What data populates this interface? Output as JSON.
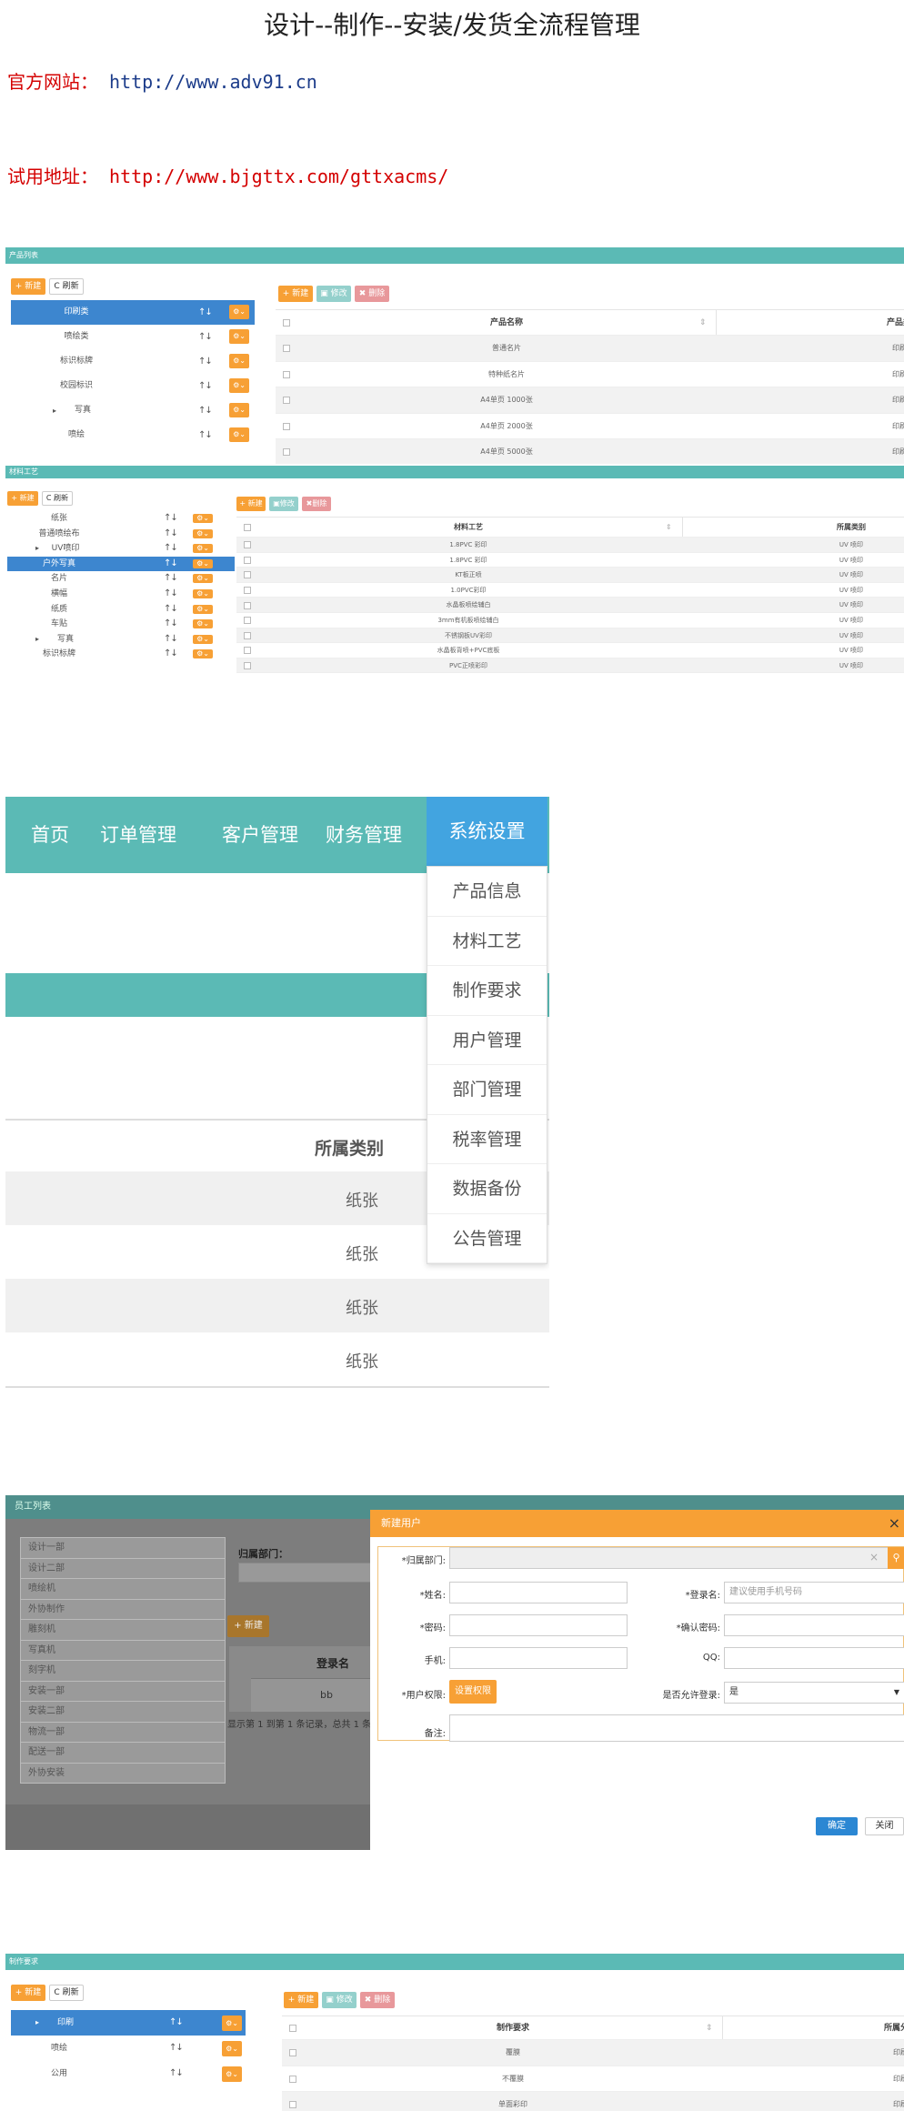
{
  "title": "设计--制作--安装/发货全流程管理",
  "official": {
    "label": "官方网站：",
    "url": "http://www.adv91.cn"
  },
  "trial": {
    "label": "试用地址：",
    "url": "http://www.bjgttx.com/gttxacms/"
  },
  "product_panel": {
    "header": "产品列表",
    "new": "+ 新建",
    "refresh": "C 刷新",
    "g_new": "+ 新建",
    "g_edit": "修改",
    "g_delete": "删除",
    "tree": [
      "印刷类",
      "喷绘类",
      "标识标牌",
      "校园标识",
      "写真",
      "喷绘"
    ],
    "columns": [
      "产品名称",
      "产品类别"
    ],
    "rows": [
      [
        "普通名片",
        "印刷类"
      ],
      [
        "特种纸名片",
        "印刷类"
      ],
      [
        "A4单页 1000张",
        "印刷类"
      ],
      [
        "A4单页 2000张",
        "印刷类"
      ],
      [
        "A4单页 5000张",
        "印刷类"
      ]
    ]
  },
  "material_panel": {
    "header": "材料工艺",
    "new": "+ 新建",
    "refresh": "C 刷新",
    "g_new": "+ 新建",
    "g_edit": "修改",
    "g_delete": "删除",
    "tree": [
      "纸张",
      "普通喷绘布",
      "UV喷印",
      "户外写真",
      "名片",
      "横幅",
      "纸质",
      "车贴",
      "写真",
      "标识标牌"
    ],
    "columns": [
      "材料工艺",
      "所属类别"
    ],
    "rows": [
      [
        "1.8PVC 彩印",
        "UV 喷印"
      ],
      [
        "1.8PVC 彩印",
        "UV 喷印"
      ],
      [
        "KT板正喷",
        "UV 喷印"
      ],
      [
        "1.0PVC彩印",
        "UV 喷印"
      ],
      [
        "水晶板喷绘辅白",
        "UV 喷印"
      ],
      [
        "3mm有机板喷绘辅白",
        "UV 喷印"
      ],
      [
        "不锈钢板UV彩印",
        "UV 喷印"
      ],
      [
        "水晶板背喷+PVC底板",
        "UV 喷印"
      ],
      [
        "PVC正喷彩印",
        "UV 喷印"
      ]
    ]
  },
  "menu": {
    "nav": [
      "首页",
      "订单管理",
      "客户管理",
      "财务管理",
      "系统设置"
    ],
    "dropdown": [
      "产品信息",
      "材料工艺",
      "制作要求",
      "用户管理",
      "部门管理",
      "税率管理",
      "数据备份",
      "公告管理"
    ],
    "column": "所属类别",
    "rows": [
      "纸张",
      "纸张",
      "纸张",
      "纸张"
    ]
  },
  "user_modal": {
    "bg_header": "员工列表",
    "departments": [
      "设计一部",
      "设计二部",
      "喷绘机",
      "外协制作",
      "雕刻机",
      "写真机",
      "刻字机",
      "安装一部",
      "安装二部",
      "物流一部",
      "配送一部",
      "外协安装"
    ],
    "dept_label": "归属部门：",
    "bg_new": "+ 新建",
    "bg_col": "登录名",
    "bg_row": "bb",
    "bg_pager": "显示第 1 到第 1 条记录，总共 1 条",
    "title": "新建用户",
    "close": "×",
    "f_dept": "*归属部门:",
    "f_name": "*姓名:",
    "f_login": "*登录名:",
    "login_ph": "建议使用手机号码",
    "f_pwd": "*密码:",
    "f_pwd2": "*确认密码:",
    "f_phone": "手机:",
    "f_qq": "QQ:",
    "f_perm": "*用户权限:",
    "perm_btn": "设置权限",
    "f_login_allow": "是否允许登录:",
    "allow_value": "是",
    "f_note": "备注:",
    "ok": "确定",
    "cancel": "关闭"
  },
  "req_panel": {
    "header": "制作要求",
    "new": "+ 新建",
    "refresh": "C 刷新",
    "g_new": "+ 新建",
    "g_edit": "修改",
    "g_delete": "删除",
    "tree": [
      "印刷",
      "喷绘",
      "公用"
    ],
    "columns": [
      "制作要求",
      "所属分类"
    ],
    "rows": [
      [
        "覆膜",
        "印刷"
      ],
      [
        "不覆膜",
        "印刷"
      ],
      [
        "单面彩印",
        "印刷"
      ]
    ]
  }
}
